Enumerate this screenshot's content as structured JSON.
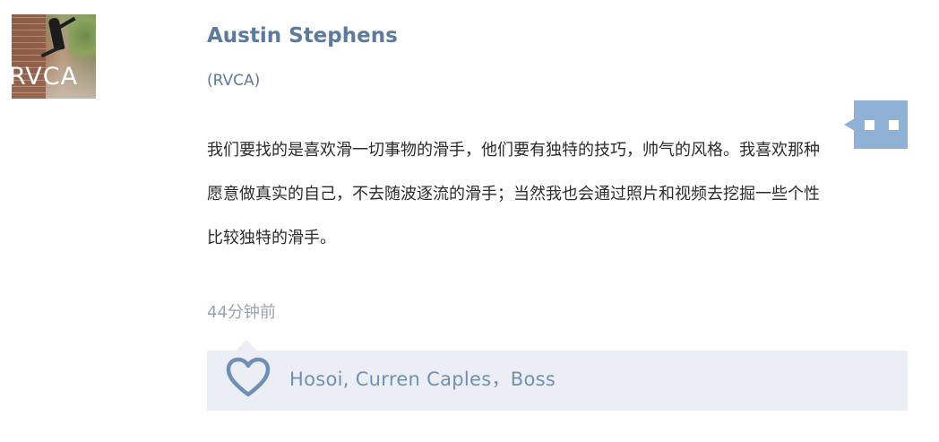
{
  "post": {
    "avatar_logo": "RVCA",
    "author_name": "Austin Stephens",
    "brand": "(RVCA)",
    "message": "我们要找的是喜欢滑一切事物的滑手，他们要有独特的技巧，帅气的风格。我喜欢那种愿意做真实的自己，不去随波逐流的滑手；当然我也会通过照片和视频去挖掘一些个性比较独特的滑手。",
    "timestamp": "44分钟前",
    "likes": {
      "icon": "heart-icon",
      "names": "Hosoi, Curren Caples，Boss"
    },
    "comment_button_icon": "comment-icon"
  },
  "colors": {
    "accent": "#5c7a9e",
    "comment_button": "#8fb1d5",
    "likes_background": "#eceef6",
    "timestamp": "#9aa3ad"
  }
}
